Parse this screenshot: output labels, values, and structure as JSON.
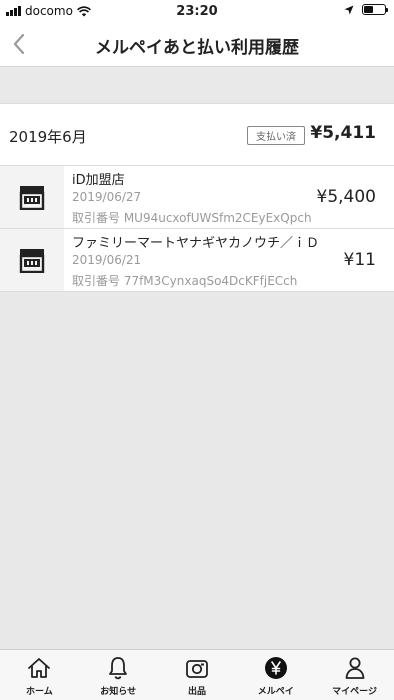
{
  "status_bar": {
    "carrier": "docomo",
    "time": "23:20"
  },
  "nav": {
    "title": "メルペイあと払い利用履歴"
  },
  "month_summary": {
    "month": "2019年6月",
    "status_badge": "支払い済",
    "total": "¥5,411"
  },
  "transactions": [
    {
      "merchant": "iD加盟店",
      "date": "2019/06/27",
      "transaction_id": "取引番号 MU94ucxofUWSfm2CEyExQpch",
      "amount": "¥5,400",
      "icon": "store-icon"
    },
    {
      "merchant": "ファミリーマートヤナギヤカノウチ／ｉＤ",
      "date": "2019/06/21",
      "transaction_id": "取引番号 77fM3CynxaqSo4DcKFfjECch",
      "amount": "¥11",
      "icon": "store-icon"
    }
  ],
  "tabbar": {
    "items": [
      {
        "label": "ホーム",
        "icon": "home-icon"
      },
      {
        "label": "お知らせ",
        "icon": "bell-icon"
      },
      {
        "label": "出品",
        "icon": "camera-icon"
      },
      {
        "label": "メルペイ",
        "icon": "merpay-yen-icon"
      },
      {
        "label": "マイページ",
        "icon": "person-icon"
      }
    ]
  }
}
